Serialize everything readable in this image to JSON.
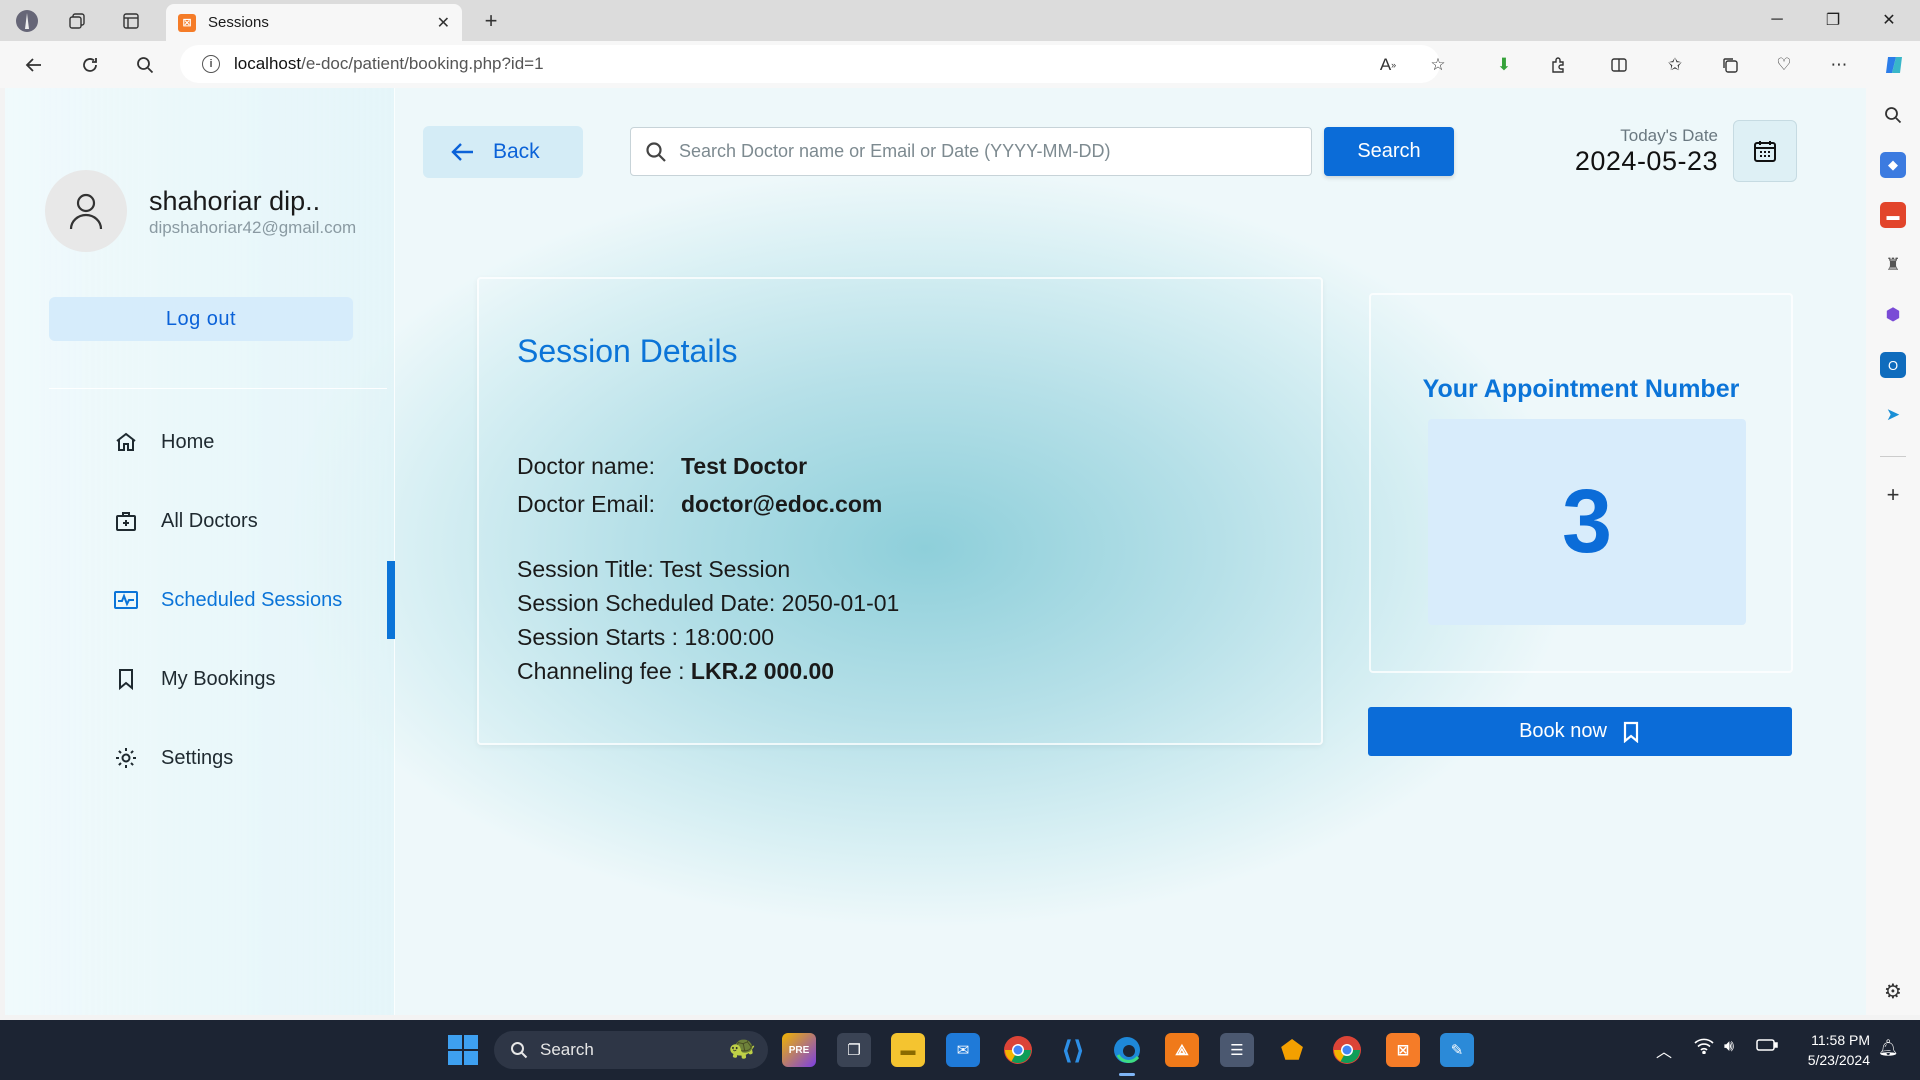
{
  "browser": {
    "tab_title": "Sessions",
    "url_host": "localhost",
    "url_path": "/e-doc/patient/booking.php?id=1"
  },
  "profile": {
    "name": "shahoriar dip..",
    "email": "dipshahoriar42@gmail.com",
    "logout_label": "Log out"
  },
  "menu": {
    "home": "Home",
    "all_doctors": "All Doctors",
    "scheduled_sessions": "Scheduled Sessions",
    "my_bookings": "My Bookings",
    "settings": "Settings"
  },
  "topbar": {
    "back_label": "Back",
    "search_placeholder": "Search Doctor name or Email or Date (YYYY-MM-DD)",
    "search_button": "Search",
    "today_label": "Today's Date",
    "today_value": "2024-05-23"
  },
  "session": {
    "heading": "Session Details",
    "doctor_name_label": "Doctor name:",
    "doctor_name": "Test Doctor",
    "doctor_email_label": "Doctor Email:",
    "doctor_email": "doctor@edoc.com",
    "title_line": "Session Title: Test Session",
    "date_line": "Session Scheduled Date: 2050-01-01",
    "starts_line": "Session Starts : 18:00:00",
    "fee_label": "Channeling fee : ",
    "fee_value": "LKR.2 000.00"
  },
  "appointment": {
    "heading": "Your Appointment Number",
    "number": "3",
    "book_label": "Book now"
  },
  "taskbar": {
    "search_label": "Search",
    "time": "11:58 PM",
    "date": "5/23/2024"
  },
  "colors": {
    "accent": "#0b6cd8",
    "taskbar": "#1c2433"
  }
}
